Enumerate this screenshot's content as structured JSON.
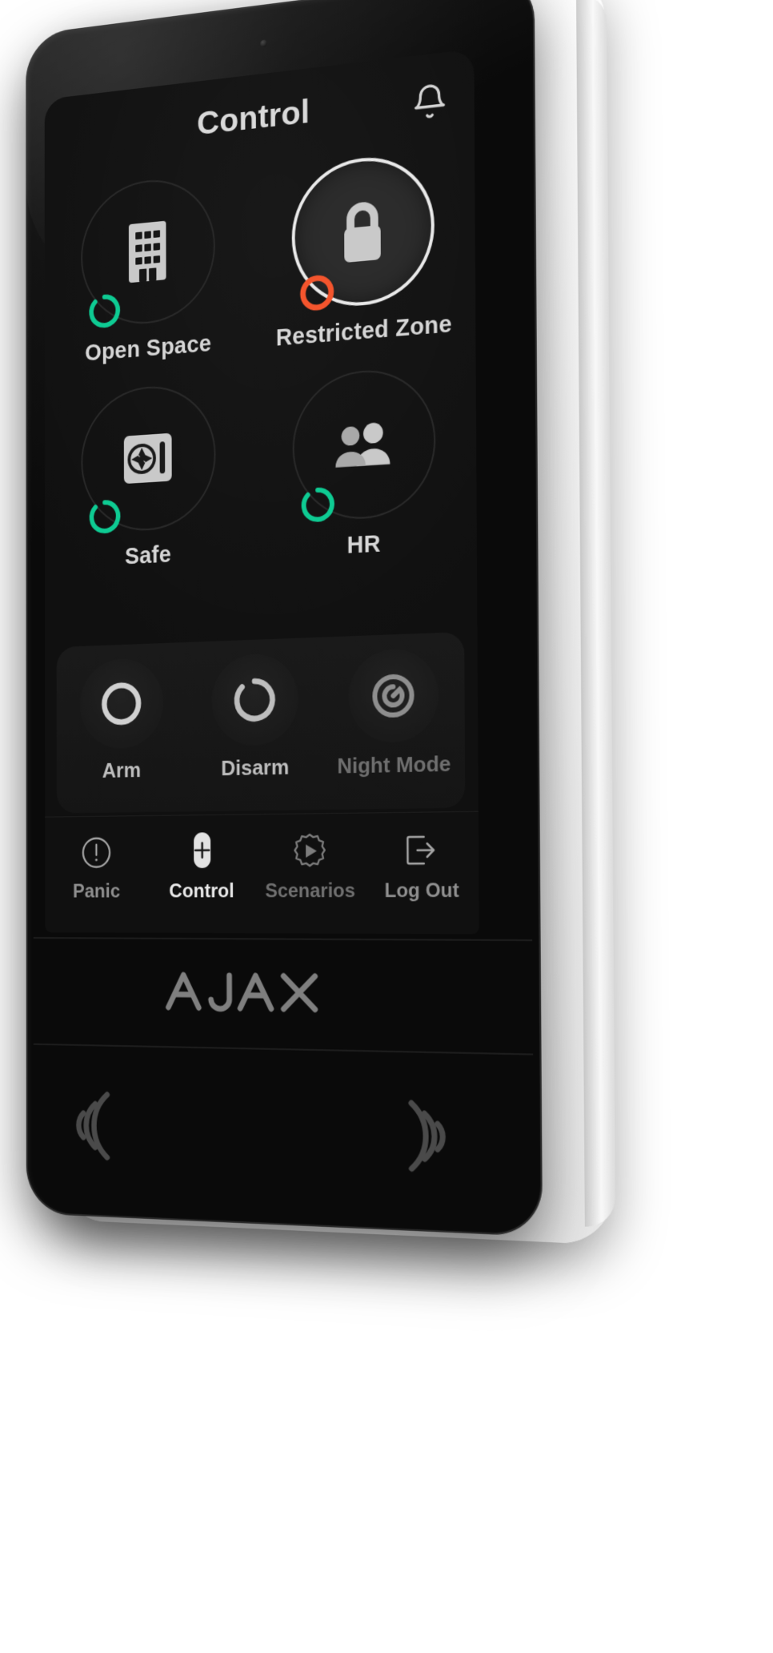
{
  "device": {
    "brand_logo": "AJAX",
    "brand_logo_name": "ajax-wordmark",
    "nfc_left_icon": "nfc-waves-left-icon",
    "nfc_right_icon": "nfc-waves-right-icon"
  },
  "screen": {
    "header": {
      "title": "Control",
      "bell_icon": "bell-icon"
    },
    "groups": [
      {
        "label": "Open Space",
        "icon": "office-building-icon",
        "state": "disarmed",
        "state_color": "#0ecb93",
        "selected": false
      },
      {
        "label": "Restricted Zone",
        "icon": "padlock-icon",
        "state": "armed",
        "state_color": "#f4552d",
        "selected": true
      },
      {
        "label": "Safe",
        "icon": "safe-vault-icon",
        "state": "disarmed",
        "state_color": "#0ecb93",
        "selected": false
      },
      {
        "label": "HR",
        "icon": "people-group-icon",
        "state": "disarmed",
        "state_color": "#0ecb93",
        "selected": false
      }
    ],
    "modes": [
      {
        "label": "Arm",
        "icon": "arm-circle-icon",
        "enabled": true
      },
      {
        "label": "Disarm",
        "icon": "disarm-circle-icon",
        "enabled": true
      },
      {
        "label": "Night Mode",
        "icon": "night-mode-circle-icon",
        "enabled": false
      }
    ],
    "nav": [
      {
        "label": "Panic",
        "icon": "panic-alert-icon",
        "active": false,
        "dim": false
      },
      {
        "label": "Control",
        "icon": "control-plus-icon",
        "active": true,
        "dim": false
      },
      {
        "label": "Scenarios",
        "icon": "scenarios-gear-play-icon",
        "active": false,
        "dim": true
      },
      {
        "label": "Log Out",
        "icon": "logout-arrow-icon",
        "active": false,
        "dim": false
      }
    ]
  },
  "colors": {
    "accent_green": "#0ecb93",
    "accent_red": "#f4552d",
    "screen_bg": "#101010",
    "text_primary": "#d6d6d6",
    "text_muted": "#8f8f8f"
  }
}
